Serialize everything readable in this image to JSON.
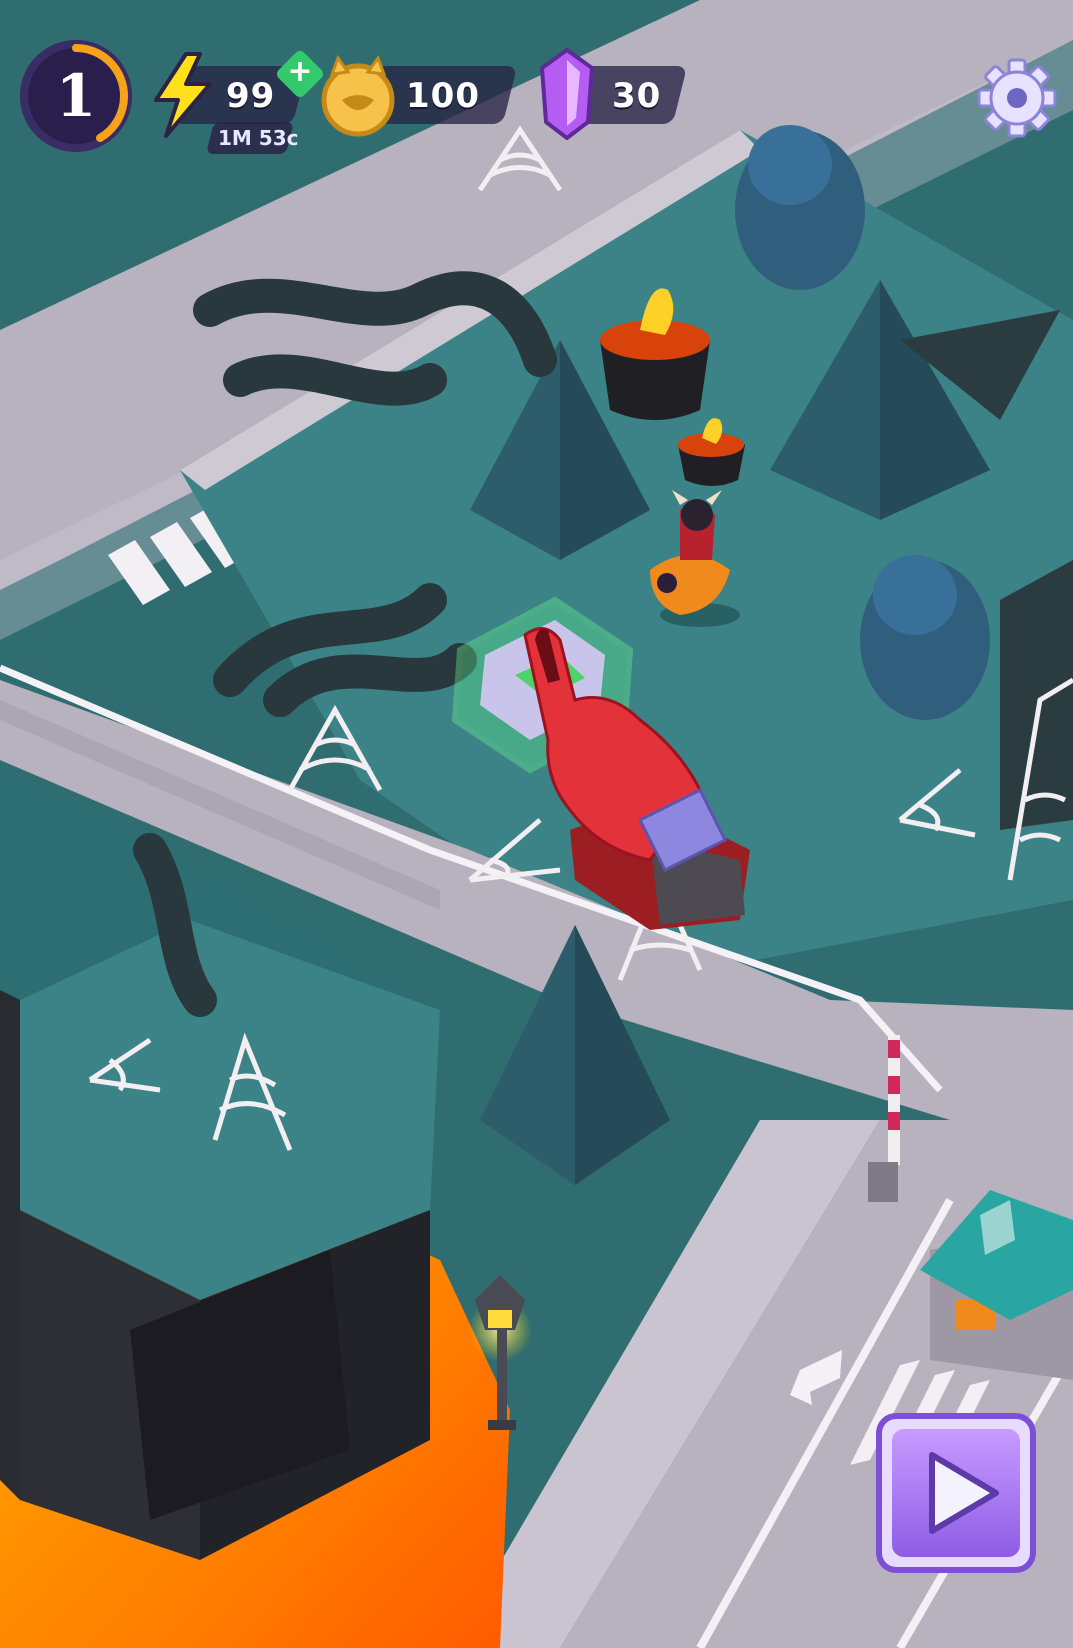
{
  "hud": {
    "level": "1",
    "energy": {
      "value": "99",
      "timer": "1M 53c",
      "add_symbol": "+"
    },
    "coins": {
      "value": "100"
    },
    "gems": {
      "value": "30"
    }
  },
  "icons": {
    "energy": "lightning-bolt-icon",
    "coin": "demon-face-coin-icon",
    "gem": "purple-crystal-icon",
    "settings": "gear-icon",
    "play": "play-triangle-icon",
    "tap_hint": "pointing-glove-hand-icon"
  },
  "colors": {
    "ground": "#2f6d70",
    "road": "#b9b4c0",
    "accent_purple": "#9b6cf0",
    "lava": "#ff8a00",
    "hud_bg": "#2a2446"
  }
}
